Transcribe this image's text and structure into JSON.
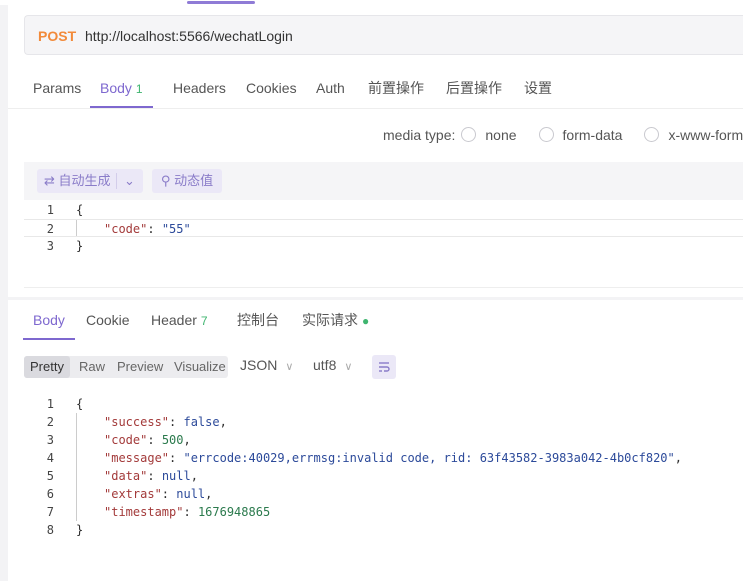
{
  "request": {
    "method": "POST",
    "url": "http://localhost:5566/wechatLogin",
    "tabs": [
      {
        "label": "Params"
      },
      {
        "label": "Body",
        "badge": "1"
      },
      {
        "label": "Headers"
      },
      {
        "label": "Cookies"
      },
      {
        "label": "Auth"
      },
      {
        "label": "前置操作"
      },
      {
        "label": "后置操作"
      },
      {
        "label": "设置"
      }
    ],
    "active_tab": "Body",
    "media_type": {
      "label": "media type:",
      "options": [
        "none",
        "form-data",
        "x-www-form-u"
      ]
    },
    "toolbar": {
      "auto_generate": "自动生成",
      "dynamic_value": "动态值"
    },
    "body_lines": [
      {
        "no": "1",
        "text": "{"
      },
      {
        "no": "2",
        "key": "\"code\"",
        "value": "\"55\""
      },
      {
        "no": "3",
        "text": "}"
      }
    ]
  },
  "response": {
    "tabs": [
      {
        "label": "Body"
      },
      {
        "label": "Cookie"
      },
      {
        "label": "Header",
        "badge": "7"
      },
      {
        "label": "控制台"
      },
      {
        "label": "实际请求"
      }
    ],
    "active_tab": "Body",
    "view_modes": [
      "Pretty",
      "Raw",
      "Preview",
      "Visualize"
    ],
    "active_view": "Pretty",
    "format": "JSON",
    "encoding": "utf8",
    "body_lines": [
      {
        "no": "1",
        "text": "{"
      },
      {
        "no": "2",
        "key": "\"success\"",
        "value": "false",
        "vtype": "b"
      },
      {
        "no": "3",
        "key": "\"code\"",
        "value": "500",
        "vtype": "n"
      },
      {
        "no": "4",
        "key": "\"message\"",
        "value": "\"errcode:40029,errmsg:invalid code, rid: 63f43582-3983a042-4b0cf820\"",
        "vtype": "s"
      },
      {
        "no": "5",
        "key": "\"data\"",
        "value": "null",
        "vtype": "b"
      },
      {
        "no": "6",
        "key": "\"extras\"",
        "value": "null",
        "vtype": "b"
      },
      {
        "no": "7",
        "key": "\"timestamp\"",
        "value": "1676948865",
        "vtype": "n"
      },
      {
        "no": "8",
        "text": "}"
      }
    ]
  },
  "colors": {
    "accent": "#7e68cf",
    "method_post": "#f28a3a",
    "badge_green": "#3fb56f"
  }
}
